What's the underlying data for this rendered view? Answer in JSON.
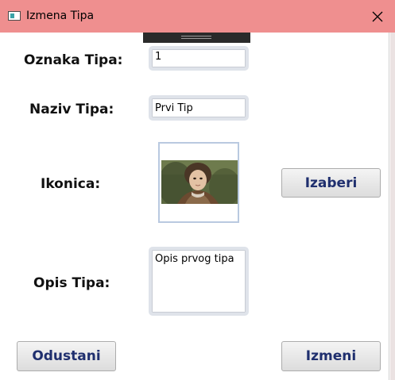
{
  "window": {
    "title": "Izmena Tipa"
  },
  "form": {
    "oznaka_label": "Oznaka Tipa:",
    "oznaka_value": "1",
    "naziv_label": "Naziv Tipa:",
    "naziv_value": "Prvi Tip",
    "ikonica_label": "Ikonica:",
    "opis_label": "Opis Tipa:",
    "opis_value": "Opis prvog tipa"
  },
  "buttons": {
    "izaberi": "Izaberi",
    "odustani": "Odustani",
    "izmeni": "Izmeni"
  },
  "colors": {
    "titlebar": "#ef8f8f",
    "button_text": "#1f2f6e",
    "textbox_border": "#dfe3ea"
  },
  "icons": {
    "app": "window-icon",
    "close": "close-icon",
    "image": "portrait-image"
  }
}
